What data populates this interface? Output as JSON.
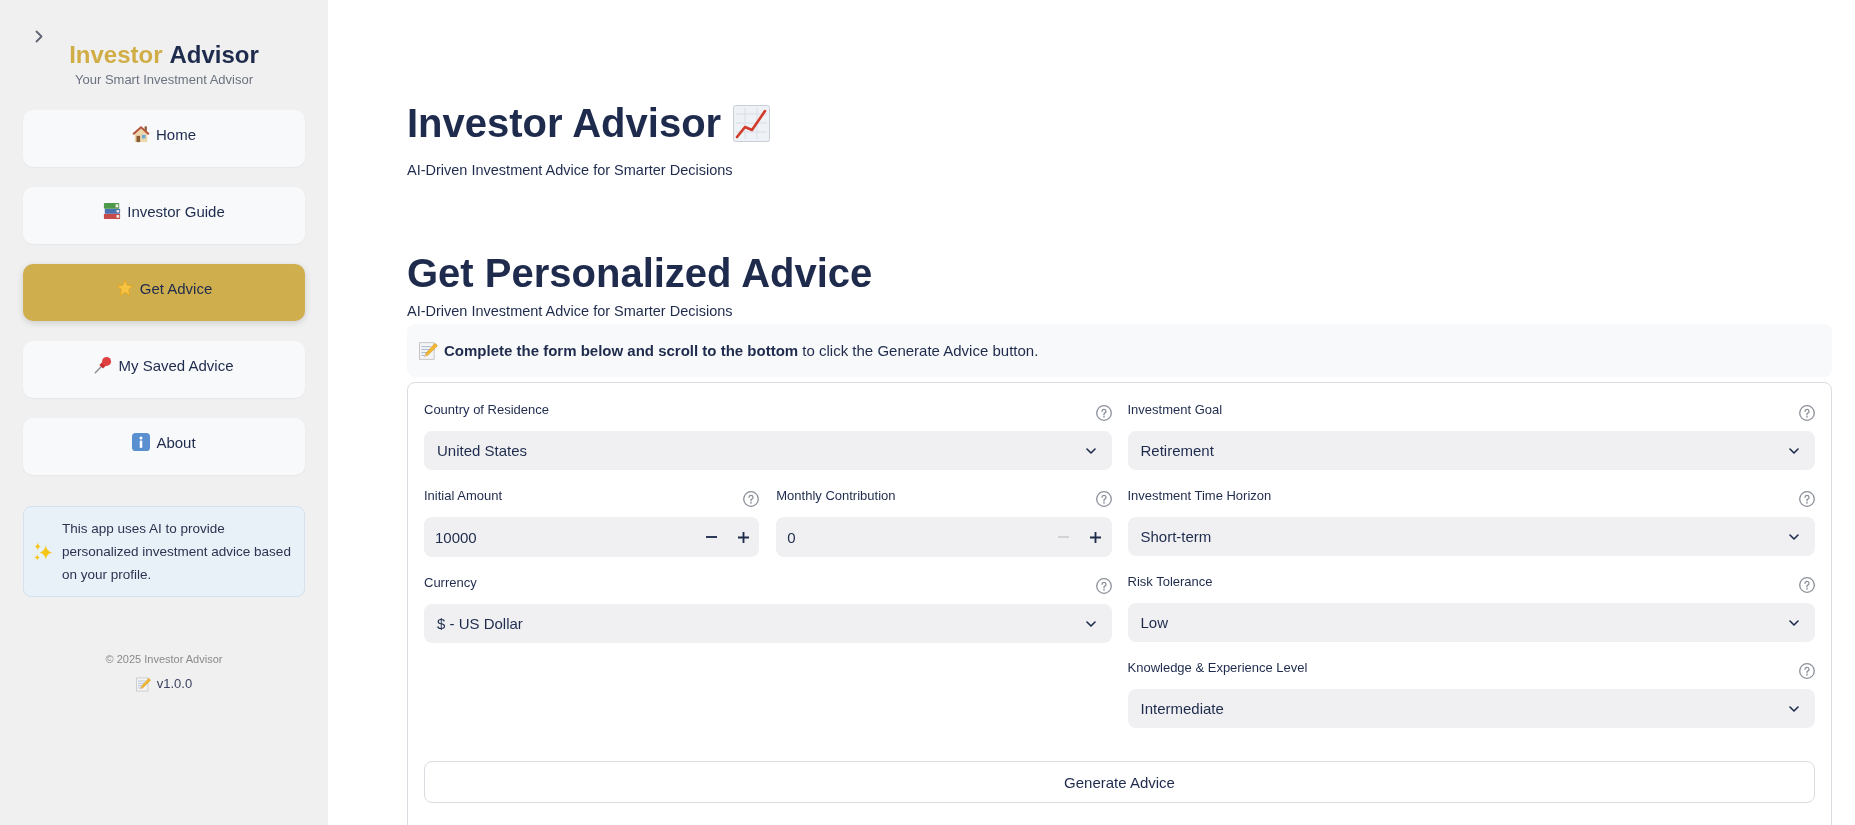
{
  "sidebar": {
    "title_accent": "Investor",
    "title_rest": "Advisor",
    "tagline": "Your Smart Investment Advisor",
    "nav_items": [
      {
        "label": "Home",
        "selected": false
      },
      {
        "label": "Investor Guide",
        "selected": false
      },
      {
        "label": "Get Advice",
        "selected": true
      },
      {
        "label": "My Saved Advice",
        "selected": false
      },
      {
        "label": "About",
        "selected": false
      }
    ],
    "info_box": {
      "text": "This app uses AI to provide personalized investment advice based on your profile."
    },
    "footer": {
      "copyright": "© 2025 Investor Advisor",
      "version": "v1.0.0"
    }
  },
  "header": {
    "title": "Investor Advisor",
    "subtitle": "AI-Driven Investment Advice for Smarter Decisions"
  },
  "section": {
    "title": "Get Personalized Advice",
    "subtitle": "AI-Driven Investment Advice for Smarter Decisions",
    "instruction": "**Complete the form below and scroll to the bottom** to click the Generate Advice button."
  },
  "form": {
    "left_fields": [
      {
        "kind": "select",
        "label": "Country of Residence",
        "value": "United States"
      },
      {
        "kind": "pair",
        "fields": [
          {
            "kind": "number",
            "label": "Initial Amount",
            "value": "10000",
            "decrement_disabled": false
          },
          {
            "kind": "number",
            "label": "Monthly Contribution",
            "value": "0",
            "decrement_disabled": true
          }
        ]
      },
      {
        "kind": "select",
        "label": "Currency",
        "value": "$ - US Dollar"
      }
    ],
    "right_fields": [
      {
        "kind": "select",
        "label": "Investment Goal",
        "value": "Retirement"
      },
      {
        "kind": "select",
        "label": "Investment Time Horizon",
        "value": "Short-term"
      },
      {
        "kind": "select",
        "label": "Risk Tolerance",
        "value": "Low"
      },
      {
        "kind": "select",
        "label": "Knowledge & Experience Level",
        "value": "Intermediate"
      }
    ],
    "submit_button": "Generate Advice"
  }
}
